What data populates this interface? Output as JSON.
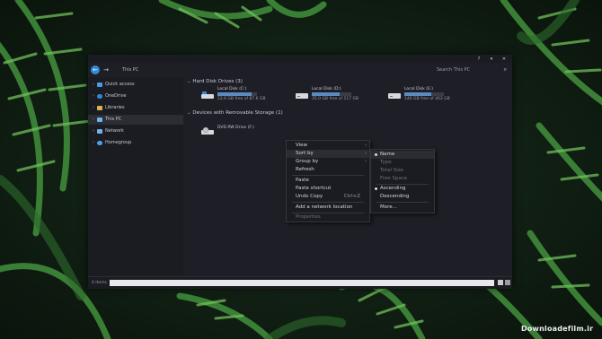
{
  "window": {
    "controls": [
      "?",
      "▾",
      "✕"
    ],
    "breadcrumb": "This PC",
    "search_placeholder": "Search This PC"
  },
  "sidebar": {
    "items": [
      {
        "label": "Quick access",
        "icon": "star-icon",
        "icon_color": "#4a9be0",
        "selected": false
      },
      {
        "label": "OneDrive",
        "icon": "cloud-icon",
        "icon_color": "#2f88d8",
        "selected": false
      },
      {
        "label": "Libraries",
        "icon": "folder-icon",
        "icon_color": "#d9b44a",
        "selected": false
      },
      {
        "label": "This PC",
        "icon": "monitor-icon",
        "icon_color": "#6fb3e8",
        "selected": true
      },
      {
        "label": "Network",
        "icon": "network-icon",
        "icon_color": "#6fb3e8",
        "selected": false
      },
      {
        "label": "Homegroup",
        "icon": "homegroup-icon",
        "icon_color": "#4aa0e0",
        "selected": false
      }
    ]
  },
  "content": {
    "groups": [
      {
        "header": "Hard Disk Drives (3)"
      },
      {
        "header": "Devices with Removable Storage (1)"
      }
    ],
    "drives": [
      {
        "name": "Local Disk (C:)",
        "free": "12.6 GB free of 87.6 GB",
        "used_fraction": 0.86
      },
      {
        "name": "Local Disk (D:)",
        "free": "35.0 GB free of 117 GB",
        "used_fraction": 0.7
      },
      {
        "name": "Local Disk (E:)",
        "free": "146 GB free of 463 GB",
        "used_fraction": 0.68
      }
    ],
    "removable": {
      "name": "DVD RW Drive (F:)"
    }
  },
  "context_menu": {
    "items": [
      {
        "label": "View",
        "has_submenu": true,
        "disabled": false
      },
      {
        "label": "Sort by",
        "has_submenu": true,
        "disabled": false,
        "highlighted": true
      },
      {
        "label": "Group by",
        "has_submenu": true,
        "disabled": false
      },
      {
        "label": "Refresh",
        "has_submenu": false,
        "disabled": false
      },
      {
        "label": "Paste",
        "has_submenu": false,
        "disabled": false
      },
      {
        "label": "Paste shortcut",
        "has_submenu": false,
        "disabled": false
      },
      {
        "label": "Undo Copy",
        "shortcut": "Ctrl+Z",
        "has_submenu": false,
        "disabled": false
      },
      {
        "label": "Add a network location",
        "has_submenu": false,
        "disabled": false
      },
      {
        "label": "Properties",
        "has_submenu": false,
        "disabled": true
      }
    ]
  },
  "sort_submenu": {
    "items": [
      {
        "label": "Name",
        "checked": true,
        "disabled": false
      },
      {
        "label": "Type",
        "checked": false,
        "disabled": true
      },
      {
        "label": "Total Size",
        "checked": false,
        "disabled": true
      },
      {
        "label": "Free Space",
        "checked": false,
        "disabled": true
      },
      {
        "label": "Ascending",
        "checked": true,
        "disabled": false
      },
      {
        "label": "Descending",
        "checked": false,
        "disabled": false
      },
      {
        "label": "More...",
        "checked": false,
        "disabled": false
      }
    ]
  },
  "status_bar": {
    "item_count": "4 items"
  },
  "watermark": "Downloadefilm.ir",
  "colors": {
    "accent": "#2f88d8",
    "window_bg": "#1e1f26",
    "drive_bar": "#5a8ac0"
  }
}
